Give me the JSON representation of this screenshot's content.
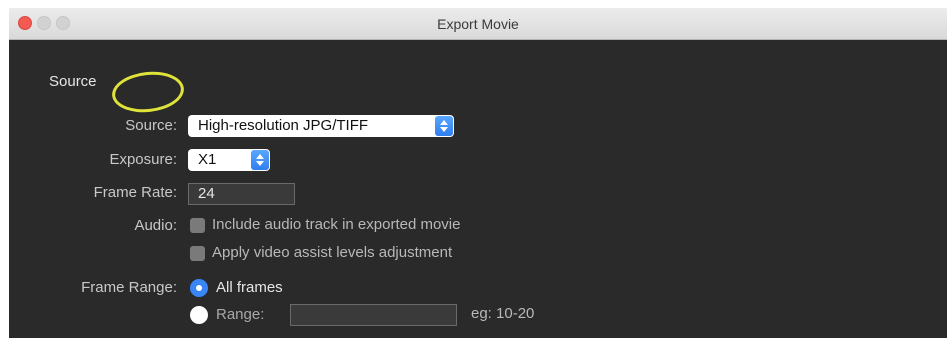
{
  "window": {
    "title": "Export Movie"
  },
  "section": {
    "header": "Source"
  },
  "source": {
    "label": "Source:",
    "value": "High-resolution JPG/TIFF"
  },
  "exposure": {
    "label": "Exposure:",
    "value": "X1"
  },
  "frame_rate": {
    "label": "Frame Rate:",
    "value": "24"
  },
  "audio": {
    "label": "Audio:",
    "include_audio_label": "Include audio track in exported movie",
    "include_audio_checked": false,
    "video_assist_label": "Apply video assist levels adjustment",
    "video_assist_checked": false
  },
  "frame_range": {
    "label": "Frame Range:",
    "all_frames_label": "All frames",
    "all_frames_selected": true,
    "range_label": "Range:",
    "range_value": "",
    "range_hint": "eg: 10-20"
  },
  "colors": {
    "accent": "#3b86f7",
    "close_button": "#f25a52",
    "annotation_ring": "#dfe33a",
    "background": "#2a2a2a"
  }
}
